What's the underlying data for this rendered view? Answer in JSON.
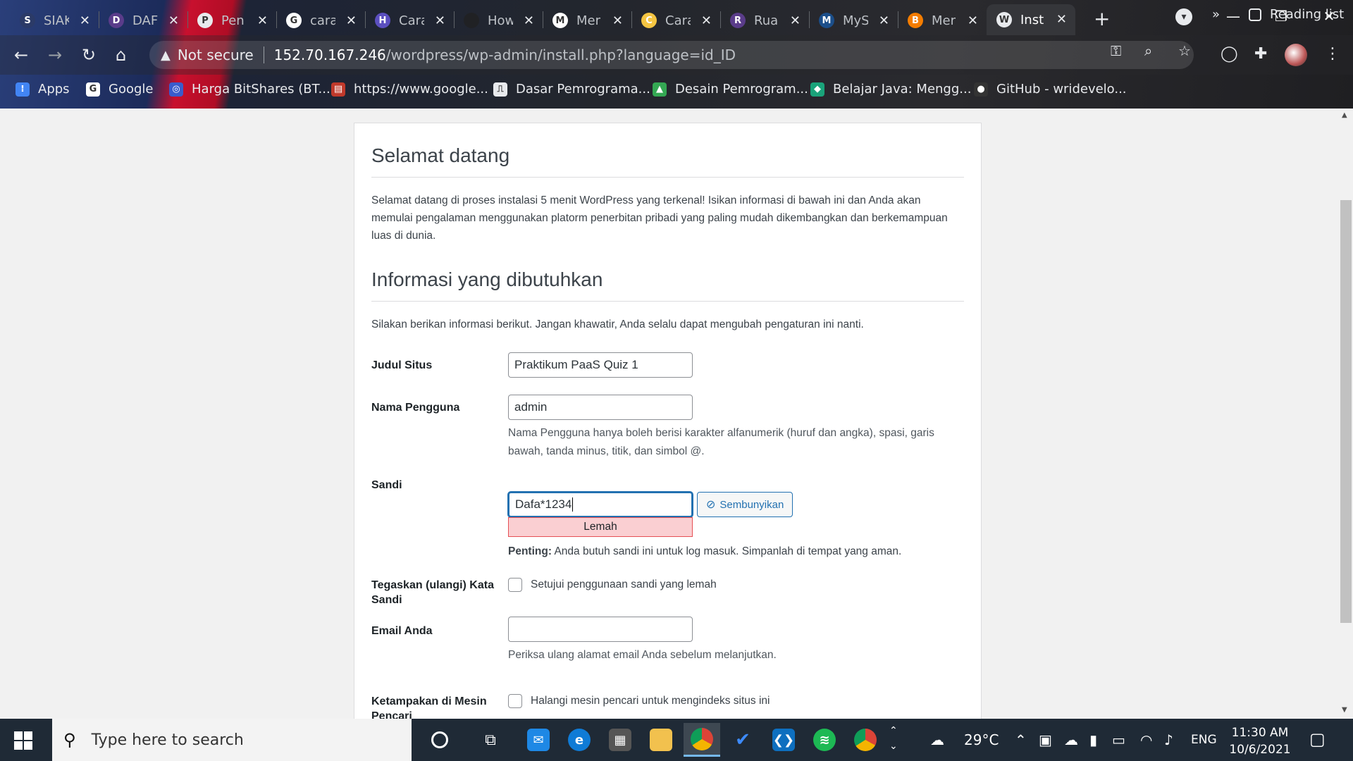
{
  "browser": {
    "tabs": [
      {
        "title": "SIAK",
        "fav_color": "#2b3a67",
        "fav_glyph": "S"
      },
      {
        "title": "DAF",
        "fav_color": "#5a3c8a",
        "fav_glyph": "D"
      },
      {
        "title": "Pen",
        "fav_color": "#e8eaed",
        "fav_glyph": "P"
      },
      {
        "title": "cara",
        "fav_color": "#ffffff",
        "fav_glyph": "G"
      },
      {
        "title": "Cara",
        "fav_color": "#5b4fbf",
        "fav_glyph": "H"
      },
      {
        "title": "How",
        "fav_color": "#202124",
        "fav_glyph": ""
      },
      {
        "title": "Mer",
        "fav_color": "#ffffff",
        "fav_glyph": "M"
      },
      {
        "title": "Cara",
        "fav_color": "#f5c542",
        "fav_glyph": "C"
      },
      {
        "title": "Rua",
        "fav_color": "#5a3c8a",
        "fav_glyph": "R"
      },
      {
        "title": "MyS",
        "fav_color": "#1b4e8a",
        "fav_glyph": "M"
      },
      {
        "title": "Mer",
        "fav_color": "#f57d00",
        "fav_glyph": "B"
      },
      {
        "title": "Inst",
        "fav_color": "#e8eaed",
        "fav_glyph": "W"
      }
    ],
    "active_tab_index": 11,
    "address": {
      "warning": "Not secure",
      "host": "152.70.167.246",
      "path": "/wordpress/wp-admin/install.php?language=id_ID"
    },
    "bookmarks": [
      {
        "label": "Apps",
        "color": "#4285f4"
      },
      {
        "label": "Google",
        "color": "#ffffff"
      },
      {
        "label": "Harga BitShares (BT...",
        "color": "#3a5ccc"
      },
      {
        "label": "https://www.google...",
        "color": "#c0392b"
      },
      {
        "label": "Dasar Pemrograma...",
        "color": "#e8eaed"
      },
      {
        "label": "Desain Pemrogram...",
        "color": "#34a853"
      },
      {
        "label": "Belajar Java: Mengg...",
        "color": "#1aa37a"
      },
      {
        "label": "GitHub - wridevelo...",
        "color": "#333333"
      }
    ],
    "bookmarks_overflow": "»",
    "reading_list": "Reading list"
  },
  "page": {
    "welcome_title": "Selamat datang",
    "welcome_text": "Selamat datang di proses instalasi 5 menit WordPress yang terkenal! Isikan informasi di bawah ini dan Anda akan memulai pengalaman menggunakan platorm penerbitan pribadi yang paling mudah dikembangkan dan berkemampuan luas di dunia.",
    "info_title": "Informasi yang dibutuhkan",
    "info_text": "Silakan berikan informasi berikut. Jangan khawatir, Anda selalu dapat mengubah pengaturan ini nanti.",
    "site_title_label": "Judul Situs",
    "site_title_value": "Praktikum PaaS Quiz 1",
    "username_label": "Nama Pengguna",
    "username_value": "admin",
    "username_desc": "Nama Pengguna hanya boleh berisi karakter alfanumerik (huruf dan angka), spasi, garis bawah, tanda minus, titik, dan simbol @.",
    "password_label": "Sandi",
    "password_value": "Dafa*1234",
    "hide_button": "Sembunyikan",
    "strength": "Lemah",
    "important_bold": "Penting:",
    "important_text": " Anda butuh sandi ini untuk log masuk. Simpanlah di tempat yang aman.",
    "confirm_label": "Tegaskan (ulangi) Kata Sandi",
    "confirm_checkbox": "Setujui penggunaan sandi yang lemah",
    "email_label": "Email Anda",
    "email_value": "",
    "email_desc": "Periksa ulang alamat email Anda sebelum melanjutkan.",
    "search_label": "Ketampakan di Mesin Pencari",
    "search_checkbox": "Halangi mesin pencari untuk mengindeks situs ini"
  },
  "taskbar": {
    "search_placeholder": "Type here to search",
    "weather": "29°C",
    "language": "ENG",
    "time": "11:30 AM",
    "date": "10/6/2021"
  },
  "colors": {
    "wp_blue": "#2271b1",
    "weak_bg": "#facfd2",
    "weak_border": "#e65054"
  }
}
